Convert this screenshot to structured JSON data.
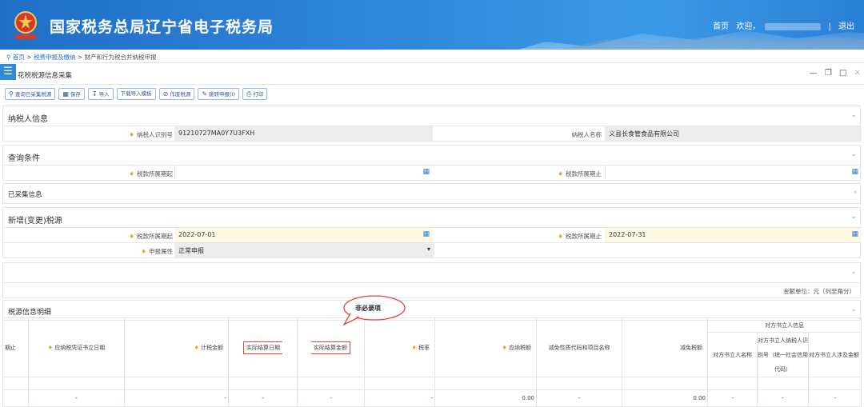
{
  "header": {
    "title": "国家税务总局辽宁省电子税务局",
    "home": "首页",
    "welcome": "欢迎，",
    "logout": "退出"
  },
  "breadcrumb": {
    "home": "首页",
    "sep": ">",
    "level1": "税费申报及缴纳",
    "level2": "财产和行为税合并纳税申报"
  },
  "panel": {
    "title": "花税税源信息采集",
    "menu_icon": "menu-icon"
  },
  "toolbar": {
    "query": "查询已采集税源",
    "save": "保存",
    "import": "导入",
    "download": "下载导入模板",
    "void": "作废税源",
    "jump": "跳转申报(I)",
    "print": "打印"
  },
  "taxpayer": {
    "section": "纳税人信息",
    "id_label": "纳税人识别号",
    "id_value": "91210727MA0Y7U3FXH",
    "name_label": "纳税人名称",
    "name_value": "义县长食管食品有限公司"
  },
  "query": {
    "section": "查询条件",
    "start_label": "税款所属期起",
    "end_label": "税款所属期止"
  },
  "collected": {
    "section": "已采集信息"
  },
  "addsrc": {
    "section": "新增(变更)税源",
    "start_label": "税款所属期起",
    "start_value": "2022-07-01",
    "end_label": "税款所属期止",
    "end_value": "2022-07-31",
    "attr_label": "申报属性",
    "attr_value": "正常申报"
  },
  "unit_note": "金额单位：元（列至角分）",
  "detail": {
    "section": "税源信息明细",
    "callout": "非必录项"
  },
  "table": {
    "h_counterparty": "对方书立人信息",
    "cols": [
      "期止",
      "应纳税凭证书立日期",
      "计税金额",
      "实际结算日期",
      "实际结算金额",
      "税率",
      "应纳税额",
      "减免性质代码和项目名称",
      "减免税额",
      "对方书立人名称",
      "对方书立人纳税人识别号（统一社会信用代码）",
      "对方书立人涉及金额"
    ],
    "row": [
      "",
      "-",
      "-",
      "-",
      "-",
      "-",
      "0.00",
      "-",
      "0.00",
      "-",
      "-",
      "-"
    ]
  }
}
